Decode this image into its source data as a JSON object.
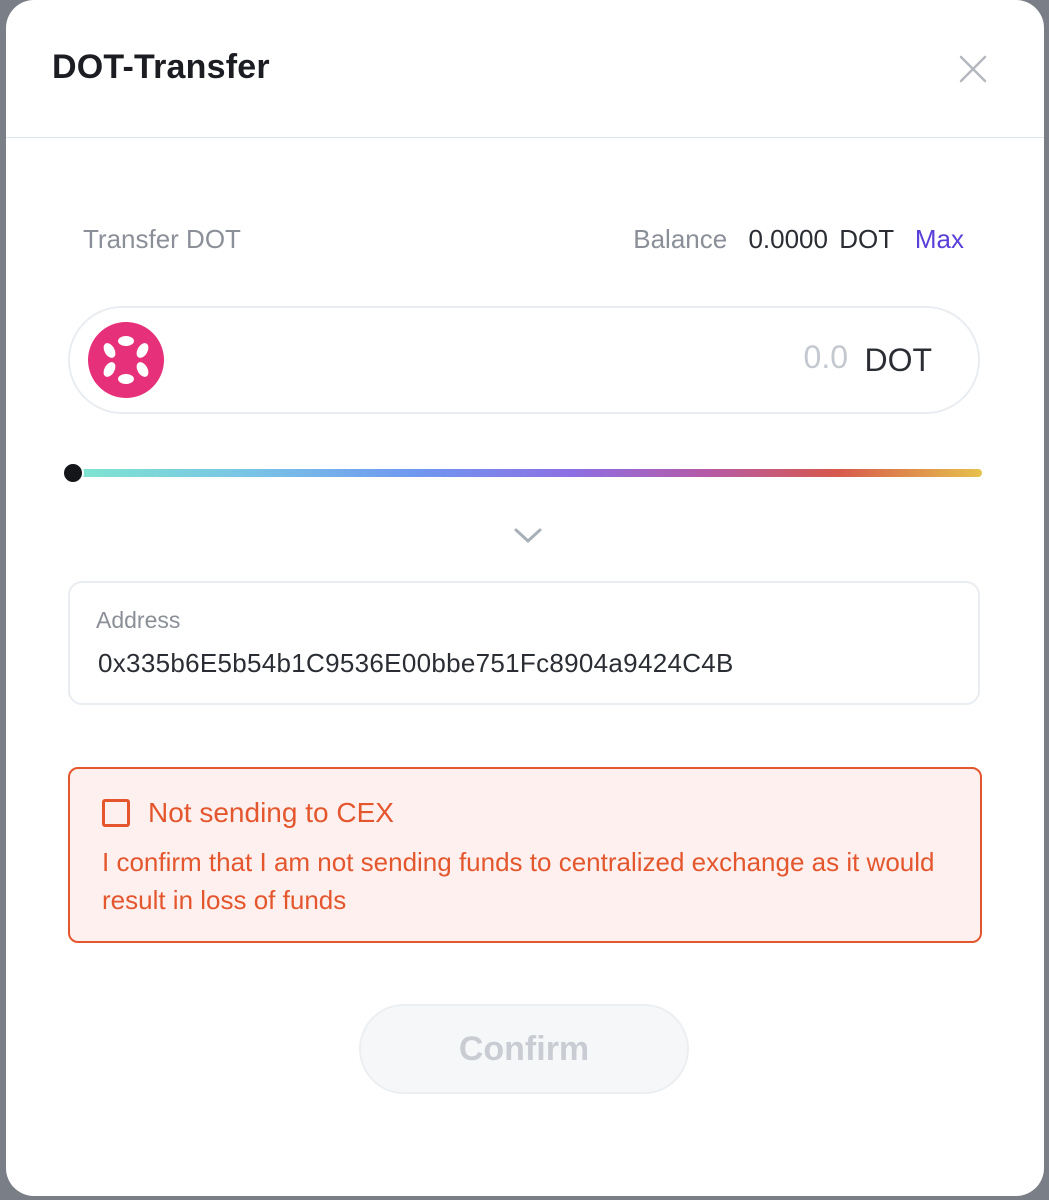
{
  "dialog": {
    "title": "DOT-Transfer",
    "close_icon": "close-icon"
  },
  "transfer": {
    "label": "Transfer DOT",
    "balance_label": "Balance",
    "balance_value": "0.0000",
    "balance_unit": "DOT",
    "max_label": "Max"
  },
  "amount": {
    "placeholder": "0.0",
    "unit": "DOT",
    "coin_icon": "polkadot-logo-icon",
    "coin_color": "#e6317a"
  },
  "slider": {
    "percent": 0
  },
  "expand_icon": "chevron-down-icon",
  "address": {
    "label": "Address",
    "value": "0x335b6E5b54b1C9536E00bbe751Fc8904a9424C4B"
  },
  "warning": {
    "checked": false,
    "title": "Not sending to CEX",
    "text": "I confirm that I am not sending funds to centralized exchange as it would result in loss of funds",
    "color": "#e4572e"
  },
  "confirm_label": "Confirm"
}
